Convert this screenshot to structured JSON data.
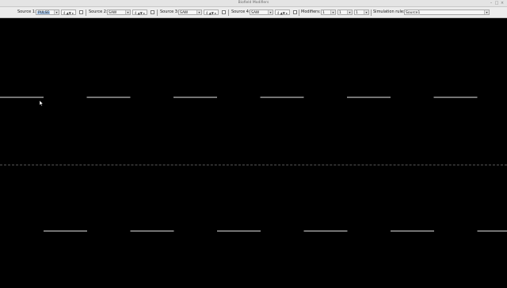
{
  "window": {
    "title": "Biofield Modifiers"
  },
  "toolbar": {
    "sources": [
      {
        "label": "Source 1:",
        "value": "PULSE",
        "spinner": "4 ▲▼ ▸"
      },
      {
        "label": "Source 2:",
        "value": "SAW",
        "spinner": "4 ▲▼ ▸"
      },
      {
        "label": "Source 3:",
        "value": "SAW",
        "spinner": "4 ▲▼ ▸"
      },
      {
        "label": "Source 4:",
        "value": "SAW",
        "spinner": "4 ▲▼ ▸"
      }
    ],
    "modifiers_label": "Modifiers:",
    "modifiers": [
      "1",
      "1",
      "1"
    ],
    "simulation_label": "Simulation rule:",
    "simulation_value": "Source1"
  },
  "waveform": {
    "trace_color": "#e8e8e8",
    "pattern": "pulse",
    "upper_segments": 6,
    "lower_segments": 6
  }
}
